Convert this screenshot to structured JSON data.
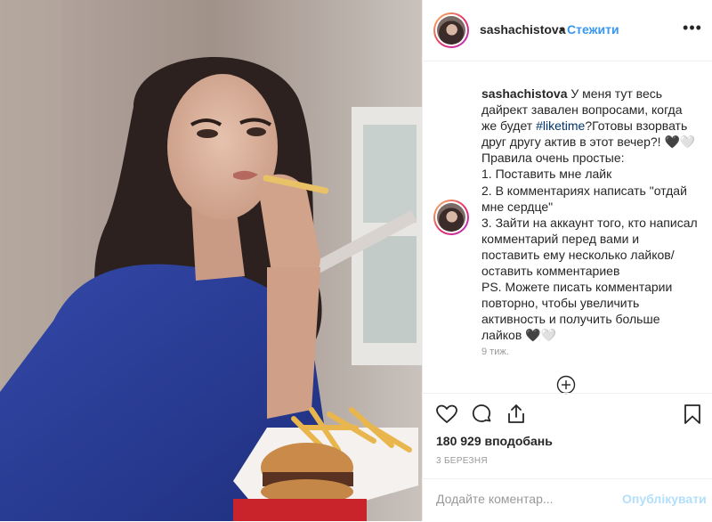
{
  "post": {
    "username": "sashachistova",
    "separator": "•",
    "follow_label": "Стежити",
    "more_label": "•••",
    "caption_username": "sashachistova",
    "caption_before": " У меня тут весь дайрект завален вопросами, когда же будет ",
    "hashtag": "#liketime",
    "caption_after": "?Готовы взорвать друг другу актив в этот вечер?! 🖤🤍\nПравила очень простые:\n1. Поставить мне лайк\n2. В комментариях написать \"отдай мне сердце\"\n3. Зайти на аккаунт того, кто написал комментарий перед вами и поставить ему несколько лайков/оставить комментариев\nPS. Можете писать комментарии повторно, чтобы увеличить активность и получить больше лайков 🖤🤍",
    "time_ago": "9 тиж.",
    "likes": "180 929 вподобань",
    "date": "3 БЕРЕЗНЯ",
    "comment_placeholder": "Додайте коментар...",
    "publish_label": "Опублікувати"
  },
  "icons": {
    "like": "heart-icon",
    "comment": "comment-icon",
    "share": "share-icon",
    "save": "bookmark-icon",
    "load_more": "plus-circle-icon"
  },
  "colors": {
    "link_blue": "#3897f0",
    "hashtag": "#003569",
    "publish_disabled": "#b2dffc",
    "border": "#efefef",
    "muted": "#999999"
  }
}
